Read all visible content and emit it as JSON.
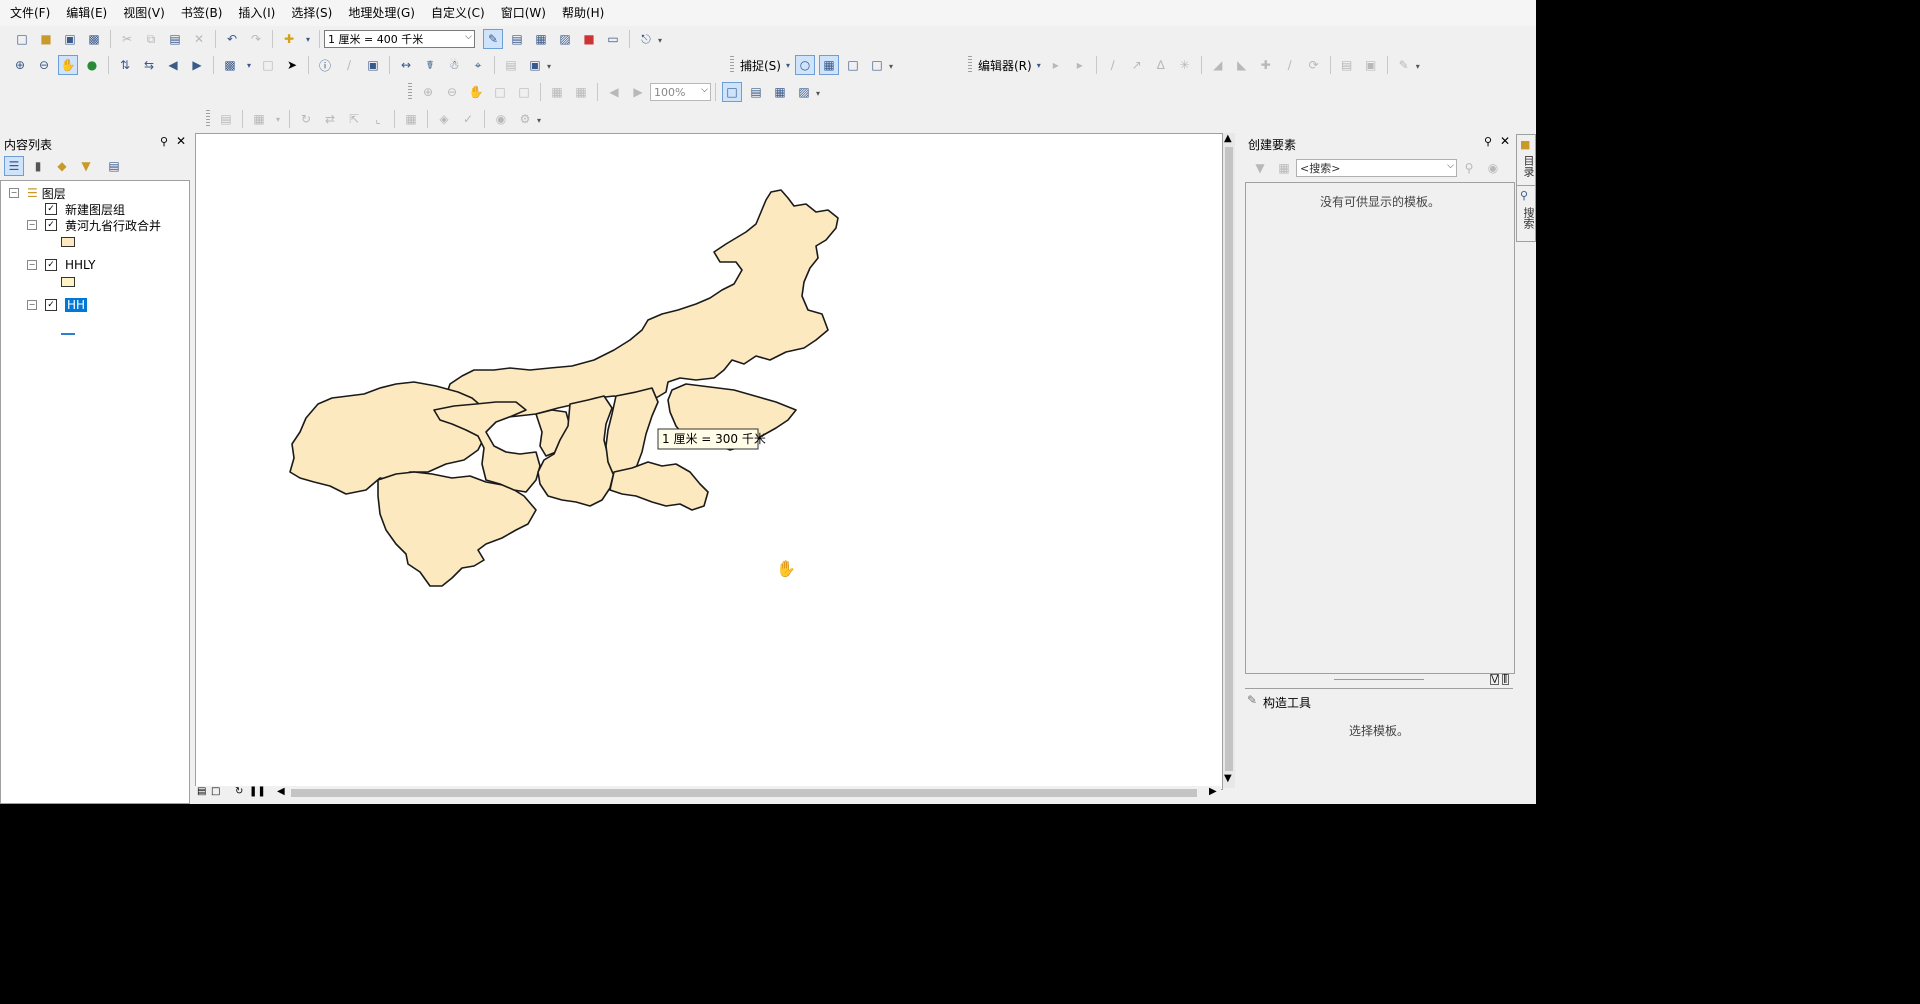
{
  "menu": [
    "文件(F)",
    "编辑(E)",
    "视图(V)",
    "书签(B)",
    "插入(I)",
    "选择(S)",
    "地理处理(G)",
    "自定义(C)",
    "窗口(W)",
    "帮助(H)"
  ],
  "standard_toolbar": {
    "scale_value": "1 厘米 = 400 千米"
  },
  "snapping": {
    "label": "捕捉(S)"
  },
  "editor": {
    "label": "编辑器(R)"
  },
  "layout_toolbar": {
    "zoom_value": "100%"
  },
  "toc": {
    "title": "内容列表",
    "root": "图层",
    "layers": [
      {
        "name": "新建图层组",
        "checked": true
      },
      {
        "name": "黄河九省行政合并",
        "checked": true
      },
      {
        "name": "HHLY",
        "checked": true
      },
      {
        "name": "HH",
        "checked": true,
        "selected": true
      }
    ],
    "colors": {
      "polygon_fill": "#fde9c0",
      "line": "#2a7fcf",
      "selection": "#0078d7"
    }
  },
  "map": {
    "scale_tooltip": "1 厘米 = 300 千米",
    "fill_color": "#fde9c0",
    "outline_color": "#1a1a1a"
  },
  "create_features": {
    "title": "创建要素",
    "search_placeholder": "<搜索>",
    "empty_message": "没有可供显示的模板。",
    "construct_title": "构造工具",
    "construct_message": "选择模板。"
  },
  "side_tabs": [
    "目录",
    "搜索"
  ]
}
